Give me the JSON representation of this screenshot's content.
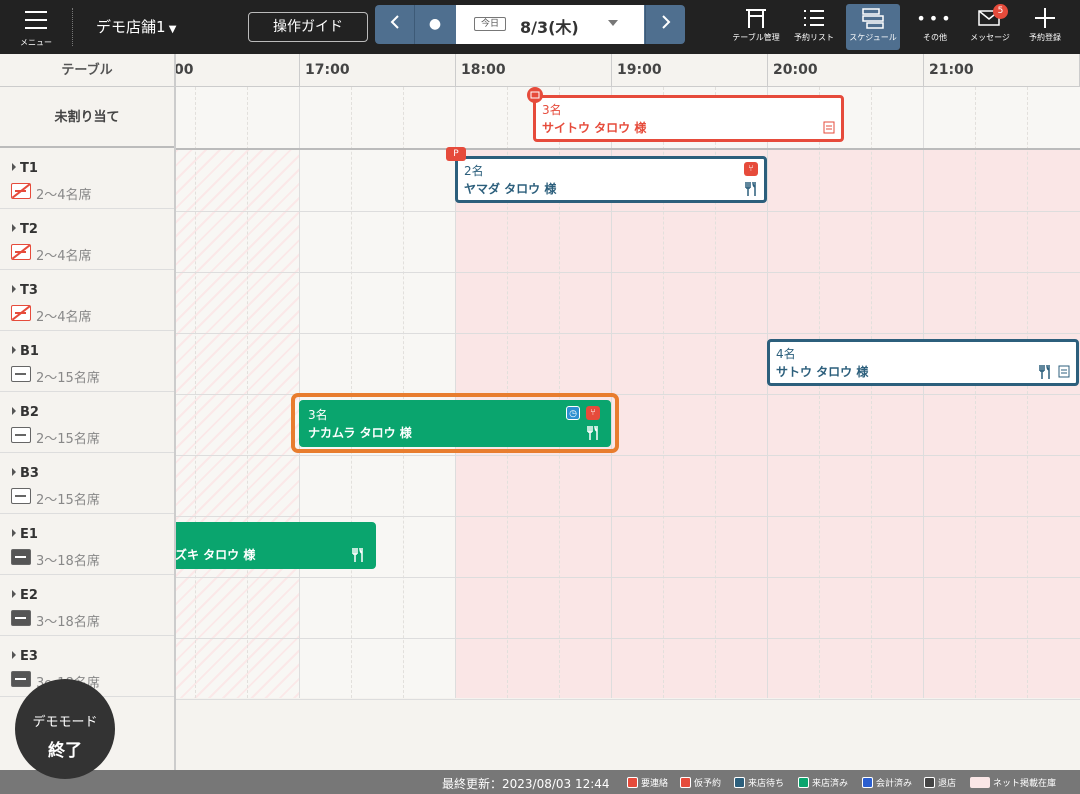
{
  "header": {
    "menu_label": "メニュー",
    "store_name": "デモ店舗1",
    "guide_label": "操作ガイド",
    "today_label": "今日",
    "date": "8/3(木)",
    "tools": [
      {
        "label": "テーブル管理",
        "icon": "torii-table-icon"
      },
      {
        "label": "予約リスト",
        "icon": "list-icon"
      },
      {
        "label": "スケジュール",
        "icon": "schedule-icon"
      },
      {
        "label": "その他",
        "icon": "more-icon"
      },
      {
        "label": "メッセージ",
        "icon": "mail-icon",
        "badge": "5"
      },
      {
        "label": "予約登録",
        "icon": "plus-icon"
      }
    ]
  },
  "grid": {
    "table_header": "テーブル",
    "unassigned_label": "未割り当て",
    "hours": [
      "00",
      "17:00",
      "18:00",
      "19:00",
      "20:00",
      "21:00"
    ],
    "tables": [
      {
        "name": "T1",
        "cap": "2〜4名席",
        "icon": "ng"
      },
      {
        "name": "T2",
        "cap": "2〜4名席",
        "icon": "ng"
      },
      {
        "name": "T3",
        "cap": "2〜4名席",
        "icon": "ng"
      },
      {
        "name": "B1",
        "cap": "2〜15名席",
        "icon": "normal"
      },
      {
        "name": "B2",
        "cap": "2〜15名席",
        "icon": "normal"
      },
      {
        "name": "B3",
        "cap": "2〜15名席",
        "icon": "normal"
      },
      {
        "name": "E1",
        "cap": "3〜18名席",
        "icon": "dark"
      },
      {
        "name": "E2",
        "cap": "3〜18名席",
        "icon": "dark"
      },
      {
        "name": "E3",
        "cap": "3〜18名席",
        "icon": "dark"
      }
    ]
  },
  "reservations": [
    {
      "people": "3名",
      "name": "サイトウ タロウ 様",
      "status": "要連絡"
    },
    {
      "people": "2名",
      "name": "ヤマダ タロウ 様",
      "status": "来店待ち"
    },
    {
      "people": "4名",
      "name": "サトウ タロウ 様",
      "status": "来店待ち"
    },
    {
      "people": "3名",
      "name": "ナカムラ タロウ 様",
      "status": "来店済み"
    },
    {
      "people": "",
      "name": "ズキ タロウ 様",
      "status": "来店済み"
    }
  ],
  "footer": {
    "updated": "最終更新：2023/08/03 12:44",
    "legend": [
      {
        "label": "要連絡",
        "color": "#e64b3b"
      },
      {
        "label": "仮予約",
        "color": "#e64b3b"
      },
      {
        "label": "来店待ち",
        "color": "#2c5f7c"
      },
      {
        "label": "来店済み",
        "color": "#0aa56e"
      },
      {
        "label": "会計済み",
        "color": "#2b5fd0"
      },
      {
        "label": "退店",
        "color": "#444444"
      },
      {
        "label": "ネット掲載在庫",
        "color": "#fae6e6"
      }
    ]
  },
  "demo": {
    "line1": "デモモード",
    "line2": "終了"
  }
}
